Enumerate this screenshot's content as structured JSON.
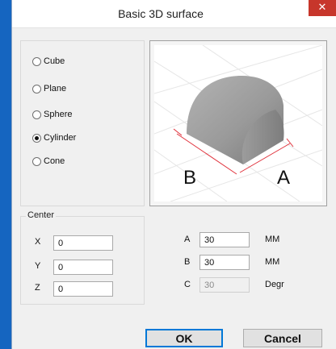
{
  "window": {
    "title": "Basic 3D surface",
    "close_glyph": "✕"
  },
  "shape_options": {
    "items": [
      {
        "label": "Cube",
        "checked": false
      },
      {
        "label": "Plane",
        "checked": false
      },
      {
        "label": "Sphere",
        "checked": false
      },
      {
        "label": "Cylinder",
        "checked": true
      },
      {
        "label": "Cone",
        "checked": false
      }
    ],
    "selected": "Cylinder"
  },
  "preview": {
    "label_b": "B",
    "label_a": "A",
    "accent": "#e0303a"
  },
  "center": {
    "legend": "Center",
    "x_label": "X",
    "x_value": "0",
    "y_label": "Y",
    "y_value": "0",
    "z_label": "Z",
    "z_value": "0"
  },
  "dimensions": {
    "a_label": "A",
    "a_value": "30",
    "a_unit": "MM",
    "b_label": "B",
    "b_value": "30",
    "b_unit": "MM",
    "c_label": "C",
    "c_value": "30",
    "c_unit": "Degr",
    "c_disabled": true
  },
  "buttons": {
    "ok_label": "OK",
    "cancel_label": "Cancel"
  }
}
